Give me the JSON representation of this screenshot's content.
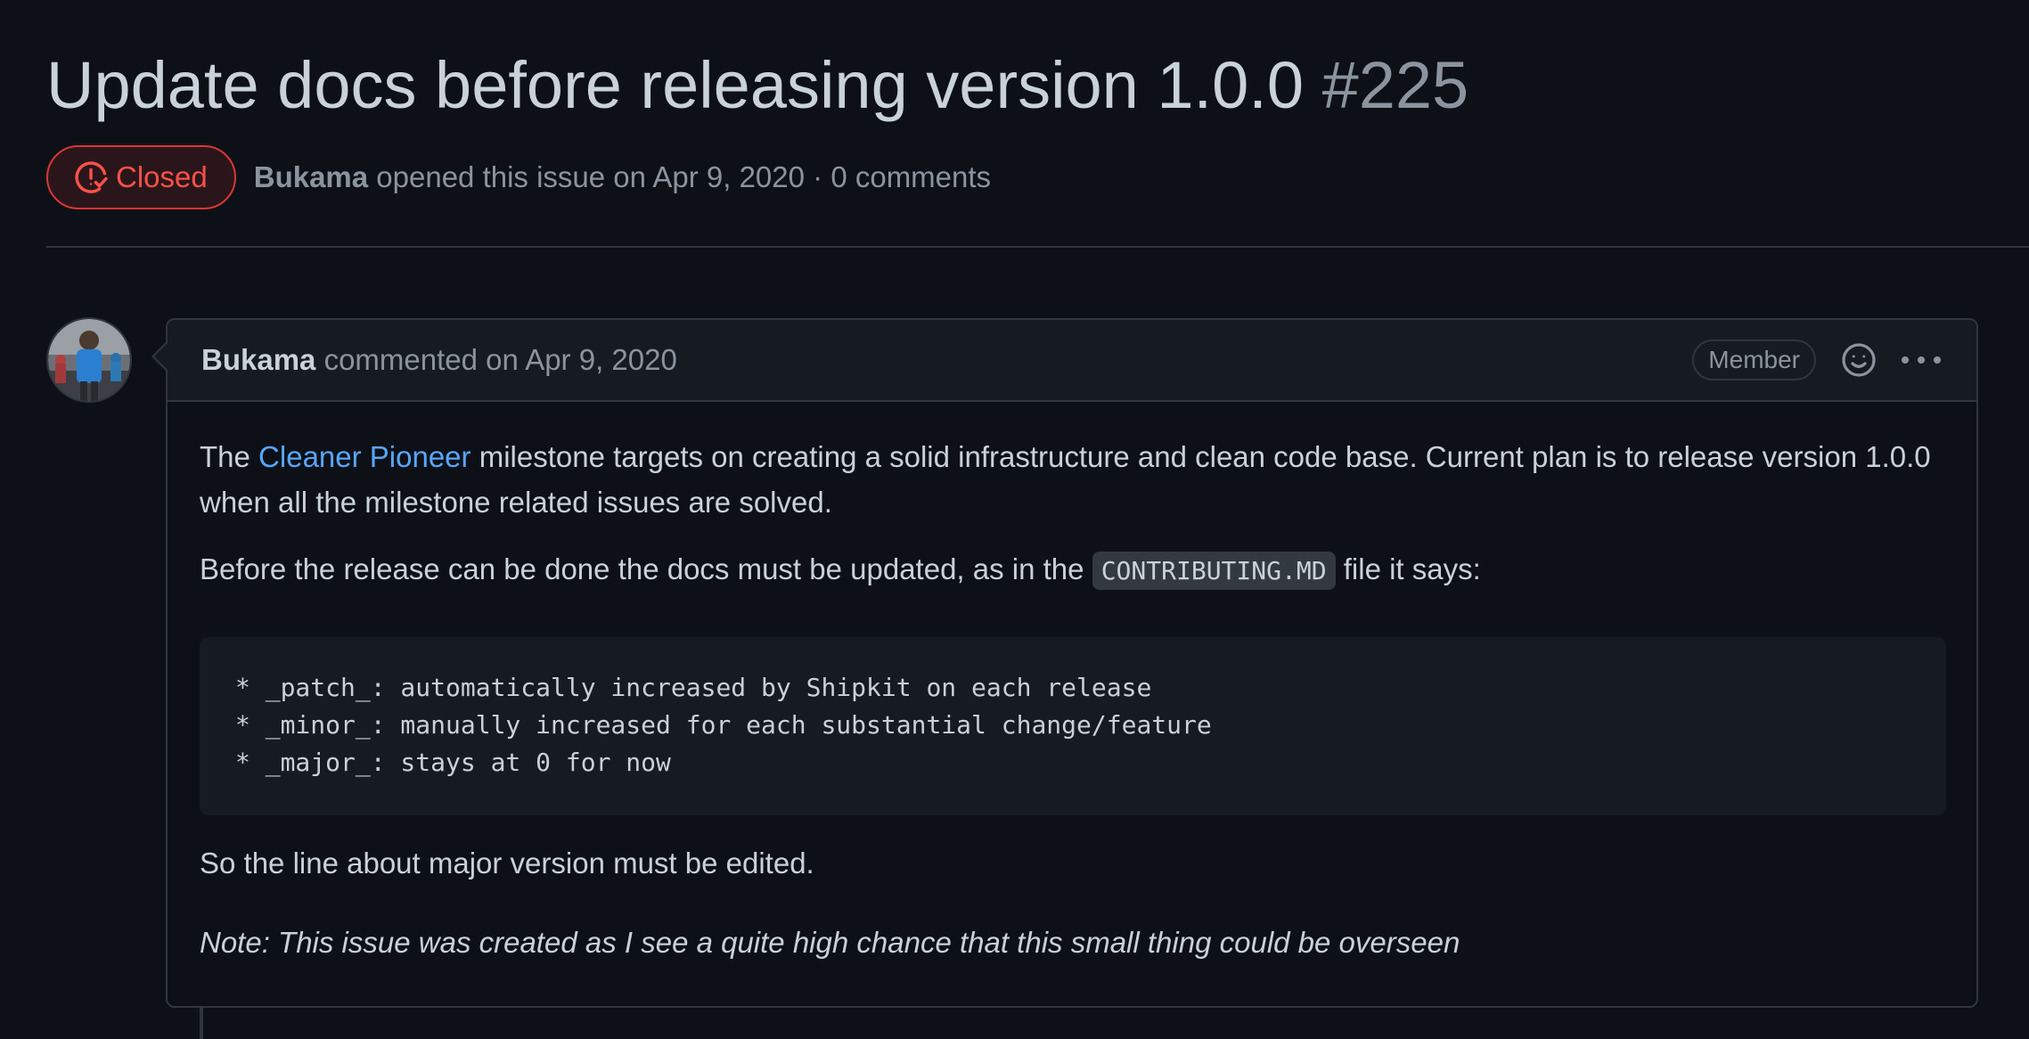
{
  "issue": {
    "title": "Update docs before releasing version 1.0.0",
    "number": "#225",
    "state_label": "Closed",
    "state_icon": "issue-closed-icon",
    "author": "Bukama",
    "opened_text": "opened this issue on Apr 9, 2020 · 0 comments"
  },
  "colors": {
    "background": "#0d1117",
    "closed_red": "#f85149",
    "link_blue": "#58a6ff",
    "border": "#30363d"
  },
  "comment": {
    "author": "Bukama",
    "commented_text": "commented on Apr 9, 2020",
    "role_label": "Member",
    "emoji_icon": "smiley-icon",
    "more_icon": "kebab-horizontal-icon",
    "body": {
      "p1_before": "The ",
      "p1_link": "Cleaner Pioneer",
      "p1_after": " milestone targets on creating a solid infrastructure and clean code base. Current plan is to release version 1.0.0 when all the milestone related issues are solved.",
      "p2_before": "Before the release can be done the docs must be updated, as in the ",
      "p2_code": "CONTRIBUTING.MD",
      "p2_after": " file it says:",
      "code_lines": [
        "* _patch_: automatically increased by Shipkit on each release",
        "* _minor_: manually increased for each substantial change/feature",
        "* _major_: stays at 0 for now"
      ],
      "p3": "So the line about major version must be edited.",
      "note": "Note: This issue was created as I see a quite high chance that this small thing could be overseen"
    }
  }
}
